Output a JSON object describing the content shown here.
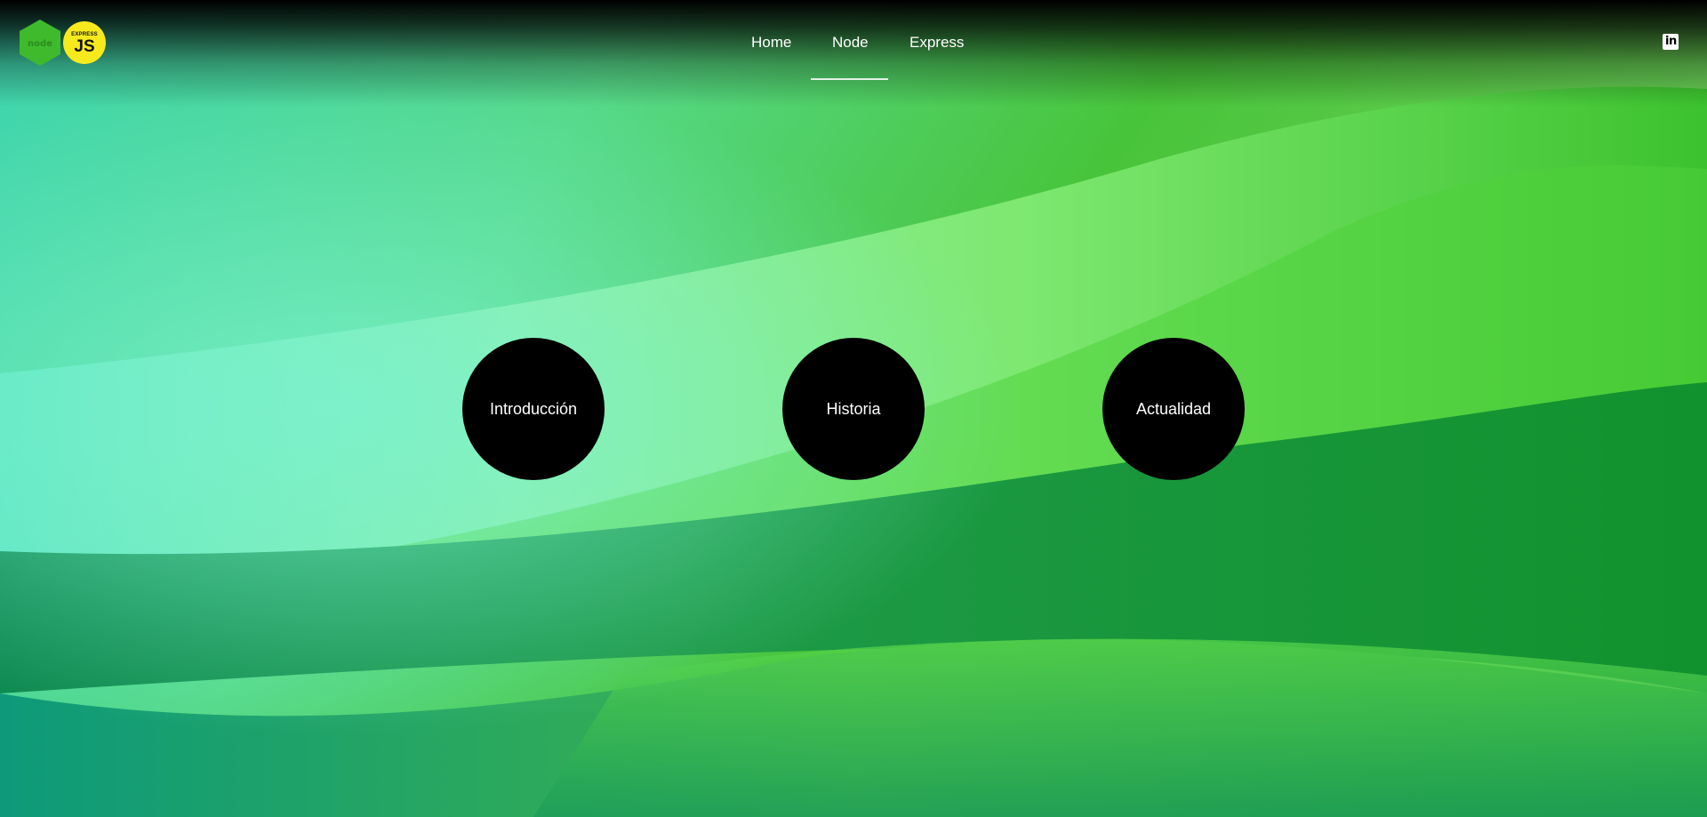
{
  "brand": {
    "node_logo_text": "node",
    "express_logo_small": "EXPRESS",
    "express_logo_big": "JS",
    "node_color": "#3fba2c",
    "express_color": "#f7ea1c"
  },
  "nav": {
    "items": [
      {
        "label": "Home"
      },
      {
        "label": "Node",
        "active": true
      },
      {
        "label": "Express"
      }
    ]
  },
  "social": {
    "icon": "linkedin-icon",
    "glyph": "in"
  },
  "sections": [
    {
      "label": "Introducción"
    },
    {
      "label": "Historia"
    },
    {
      "label": "Actualidad"
    }
  ],
  "colors": {
    "circle_bg": "#000000",
    "text": "#ffffff"
  }
}
